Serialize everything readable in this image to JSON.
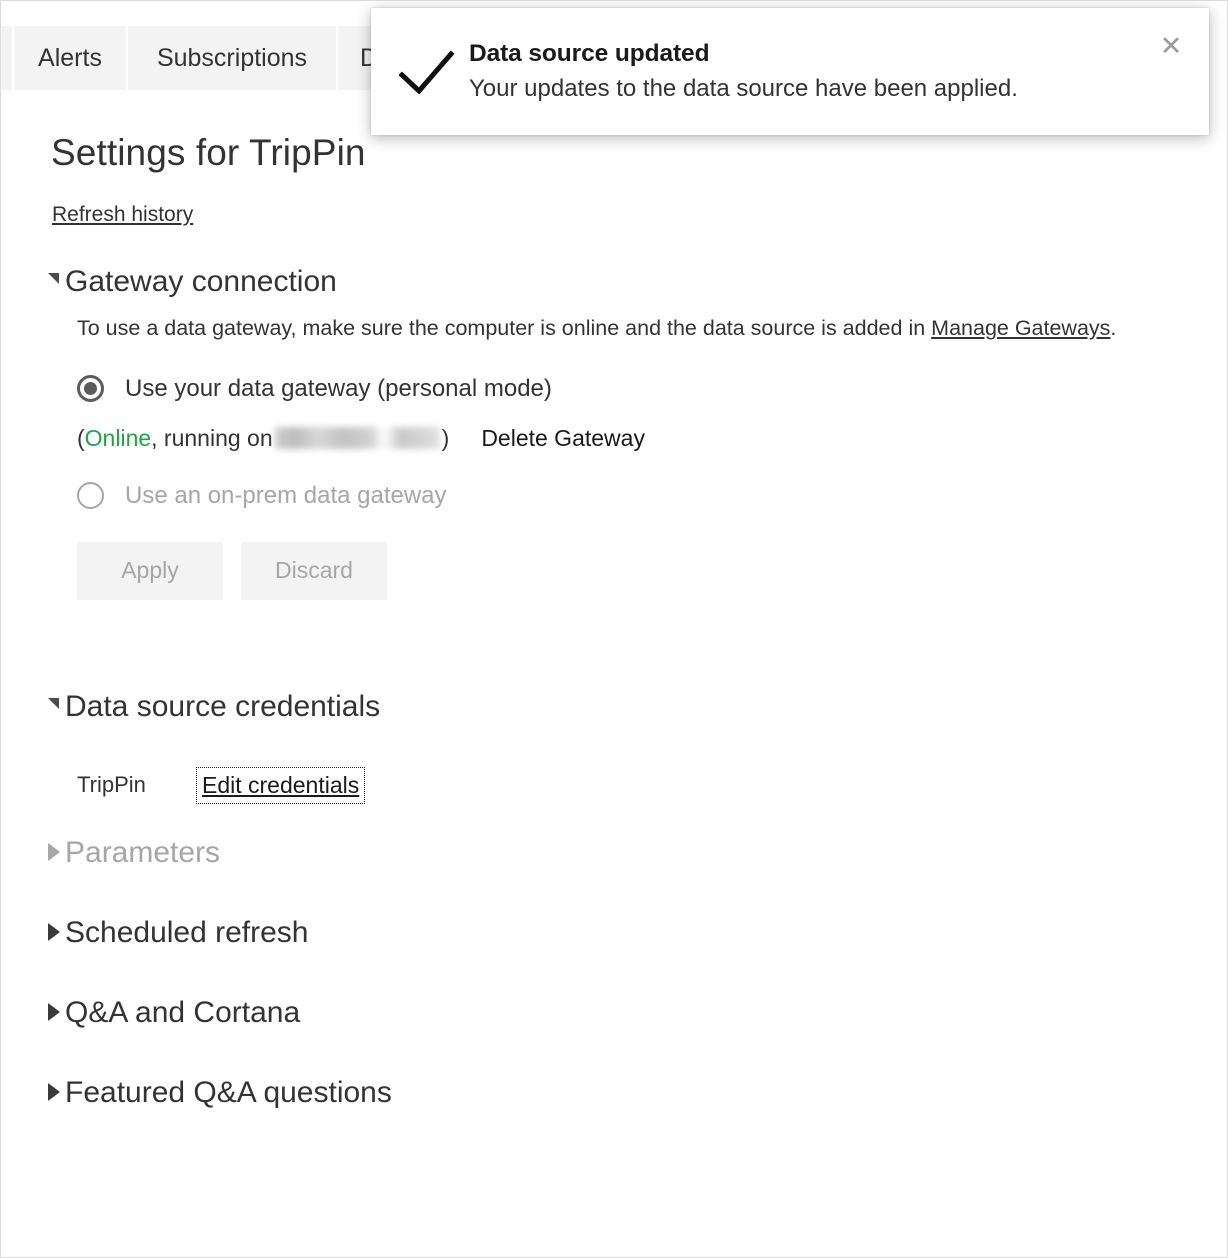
{
  "tabs": [
    {
      "label": "",
      "name": "tab-edge"
    },
    {
      "label": "Alerts",
      "name": "tab-alerts"
    },
    {
      "label": "Subscriptions",
      "name": "tab-subscriptions"
    },
    {
      "label": "D",
      "name": "tab-datasets-partial"
    }
  ],
  "header": {
    "title": "Settings for TripPin",
    "refresh_history_label": "Refresh history"
  },
  "gateway": {
    "section_title": "Gateway connection",
    "description_prefix": "To use a data gateway, make sure the computer is online and the data source is added in ",
    "description_link": "Manage Gateways",
    "description_suffix": ".",
    "personal_radio_label": "Use your data gateway (personal mode)",
    "status_open_paren": "(",
    "status_online": "Online",
    "status_running_on": ", running on ",
    "status_close_paren": ")",
    "delete_gateway_label": "Delete Gateway",
    "onprem_radio_label": "Use an on-prem data gateway",
    "apply_label": "Apply",
    "discard_label": "Discard"
  },
  "credentials": {
    "section_title": "Data source credentials",
    "source_name": "TripPin",
    "edit_label": "Edit credentials"
  },
  "collapsed_sections": [
    {
      "label": "Parameters",
      "disabled": true
    },
    {
      "label": "Scheduled refresh",
      "disabled": false
    },
    {
      "label": "Q&A and Cortana",
      "disabled": false
    },
    {
      "label": "Featured Q&A questions",
      "disabled": false
    }
  ],
  "toast": {
    "title": "Data source updated",
    "message": "Your updates to the data source have been applied.",
    "close_label": "✕",
    "icon": "checkmark-icon"
  },
  "colors": {
    "online_green": "#25a244",
    "tab_background": "#f3f3f3",
    "text": "#333333",
    "disabled_text": "#a6a6a6"
  }
}
